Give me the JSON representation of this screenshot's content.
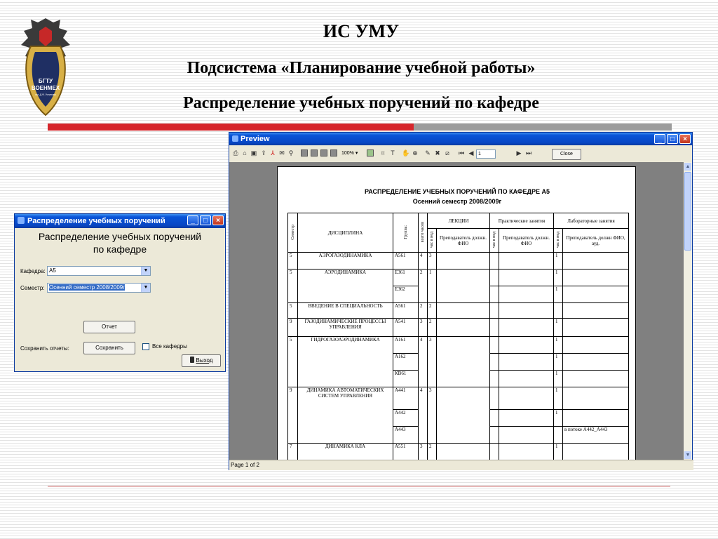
{
  "slide": {
    "line1": "ИС УМУ",
    "line2": "Подсистема «Планирование учебной работы»",
    "line3": "Распределение учебных поручений по кафедре",
    "logo_text": [
      "БГТУ",
      "ВОЕНМЕХ",
      "им. Д.Ф. Устинова"
    ]
  },
  "dialog": {
    "title": "Распределение учебных поручений",
    "heading_line1": "Распределение учебных поручений",
    "heading_line2": "по кафедре",
    "kafedra_label": "Кафедра:",
    "kafedra_value": "А5",
    "semester_label": "Семестр:",
    "semester_value": "Осенний семестр 2008/2009г",
    "report_button": "Отчет",
    "save_label": "Сохранить отчеты:",
    "save_button": "Сохранить",
    "all_departments": "Все кафедры",
    "exit_button": "Выход"
  },
  "preview": {
    "title": "Preview",
    "zoom": "100%",
    "page_input": "1",
    "close_button": "Close",
    "status": "Page 1 of 2",
    "report": {
      "title": "РАСПРЕДЕЛЕНИЕ УЧЕБНЫХ ПОРУЧЕНИЙ ПО КАФЕДРЕ     А5",
      "subtitle": "Осенний семестр 2008/2009г",
      "headers": {
        "semester": "Семестр",
        "discipline": "ДИСЦИПЛИНА",
        "group": "Группа:",
        "total_hours": "всего часов",
        "lectures": "ЛЕКЦИИ",
        "practice": "Практические занятия",
        "labs": "Лабораторные занятия",
        "hours_week": "час в нед",
        "lecturer": "Преподаватель должн. ФИО",
        "lab_lecturer": "Преподаватель должн ФИО, ауд."
      },
      "rows": [
        {
          "sem": "5",
          "disc": "АЭРОГАЗОДИНАМИКА",
          "group": "А561",
          "total": "4",
          "lec": "3",
          "lab": "1",
          "note": ""
        },
        {
          "sem": "5",
          "disc": "АЭРОДИНАМИКА",
          "group": "Е361",
          "total": "2",
          "lec": "1",
          "lab": "1",
          "note": ""
        },
        {
          "sem": "",
          "disc": "",
          "group": "Е362",
          "total": "",
          "lec": "",
          "lab": "1",
          "note": ""
        },
        {
          "sem": "5",
          "disc": "ВВЕДЕНИЕ В СПЕЦИАЛЬНОСТЬ",
          "group": "А561",
          "total": "2",
          "lec": "2",
          "lab": "",
          "note": ""
        },
        {
          "sem": "9",
          "disc": "ГАЗОДИНАМИЧЕСКИЕ ПРОЦЕССЫ УПРАВЛЕНИЯ",
          "group": "А541",
          "total": "3",
          "lec": "2",
          "lab": "1",
          "note": ""
        },
        {
          "sem": "5",
          "disc": "ГИДРОГАЗОАЭРОДИНАМИКА",
          "group": "А161",
          "total": "4",
          "lec": "3",
          "lab": "1",
          "note": ""
        },
        {
          "sem": "",
          "disc": "",
          "group": "А162",
          "total": "",
          "lec": "",
          "lab": "1",
          "note": ""
        },
        {
          "sem": "",
          "disc": "",
          "group": "КВ61",
          "total": "",
          "lec": "",
          "lab": "1",
          "note": ""
        },
        {
          "sem": "9",
          "disc": "ДИНАМИКА АВТОМАТИЧЕСКИХ СИСТЕМ УПРАВЛЕНИЯ",
          "group": "А441",
          "total": "4",
          "lec": "3",
          "lab": "1",
          "note": ""
        },
        {
          "sem": "",
          "disc": "",
          "group": "А442",
          "total": "",
          "lec": "",
          "lab": "1",
          "note": ""
        },
        {
          "sem": "",
          "disc": "",
          "group": "А443",
          "total": "",
          "lec": "",
          "lab": "",
          "note": "в потоке А442_А443"
        },
        {
          "sem": "7",
          "disc": "ДИНАМИКА КЛА",
          "group": "А551",
          "total": "3",
          "lec": "2",
          "lab": "1",
          "note": ""
        }
      ]
    }
  },
  "colors": {
    "accent_red": "#d6262c",
    "accent_grey": "#9c9c9c",
    "xp_blue": "#0746c4"
  }
}
